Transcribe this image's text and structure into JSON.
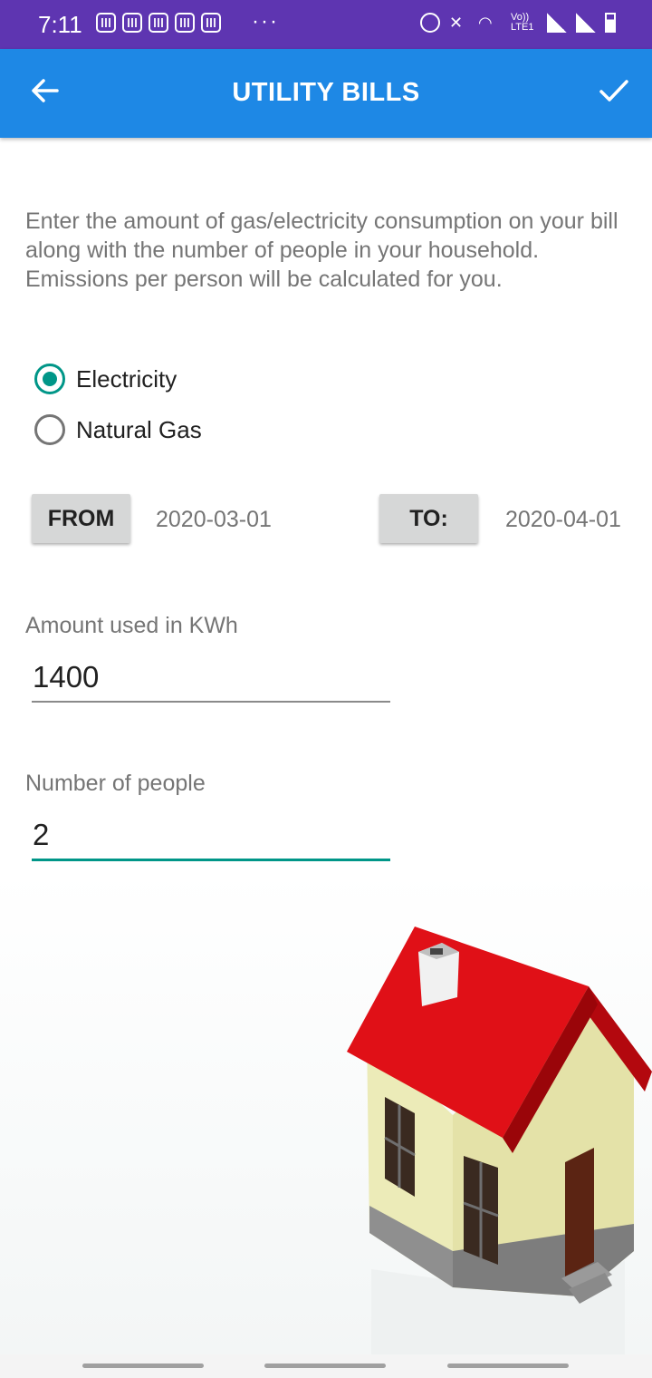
{
  "status_bar": {
    "time": "7:11",
    "overflow": "···",
    "volte": "Vo)) LTE1",
    "notification_icons": [
      "message-icon",
      "message-icon",
      "message-icon",
      "message-icon",
      "message-icon"
    ],
    "system_icons": [
      "alarm-icon",
      "mute-icon",
      "wifi-icon",
      "signal-icon",
      "signal-icon",
      "battery-icon"
    ]
  },
  "appbar": {
    "title": "UTILITY BILLS",
    "back_icon": "arrow-back-icon",
    "confirm_icon": "check-icon",
    "color": "#1e88e5"
  },
  "description": "Enter the amount of gas/electricity consumption on your bill along with the number of people in your household.\nEmissions per person will be calculated for you.",
  "utility_type": {
    "options": [
      {
        "label": "Electricity",
        "checked": true
      },
      {
        "label": "Natural Gas",
        "checked": false
      }
    ],
    "accent": "#009688"
  },
  "date_range": {
    "from_label": "FROM",
    "from_value": "2020-03-01",
    "to_label": "TO:",
    "to_value": "2020-04-01"
  },
  "amount": {
    "label": "Amount used in KWh",
    "value": "1400"
  },
  "people": {
    "label": "Number of people",
    "value": "2"
  }
}
